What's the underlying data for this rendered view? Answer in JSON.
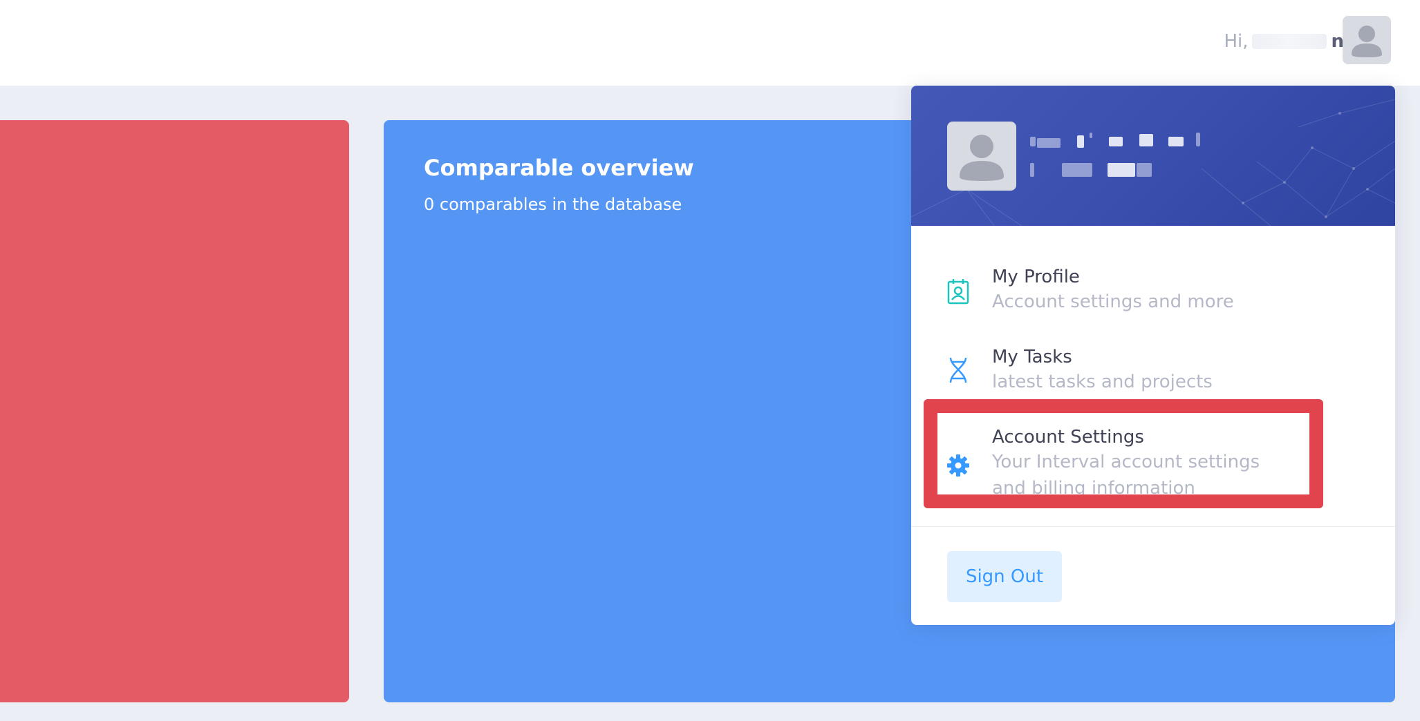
{
  "topbar": {
    "greeting_prefix": "Hi,",
    "greeting_name_tail": "n"
  },
  "cards": {
    "overview": {
      "title": "Comparable overview",
      "subtitle": "0 comparables in the database"
    }
  },
  "dropdown": {
    "menu": [
      {
        "title": "My Profile",
        "description": "Account settings and more",
        "icon": "profile-badge-icon",
        "icon_color": "#1bc5bd"
      },
      {
        "title": "My Tasks",
        "description": "latest tasks and projects",
        "icon": "dna-icon",
        "icon_color": "#3699ff"
      },
      {
        "title": "Account Settings",
        "description_line1": "Your Interval account settings",
        "description_line2": "and billing information",
        "icon": "gear-icon",
        "icon_color": "#3699ff"
      }
    ],
    "sign_out_label": "Sign Out"
  },
  "colors": {
    "red_card": "#e25b65",
    "blue_card": "#5596f5",
    "header": "#3a4fae",
    "highlight": "#e2444e",
    "sign_out_bg": "#e1f0ff",
    "sign_out_text": "#3699ff"
  }
}
